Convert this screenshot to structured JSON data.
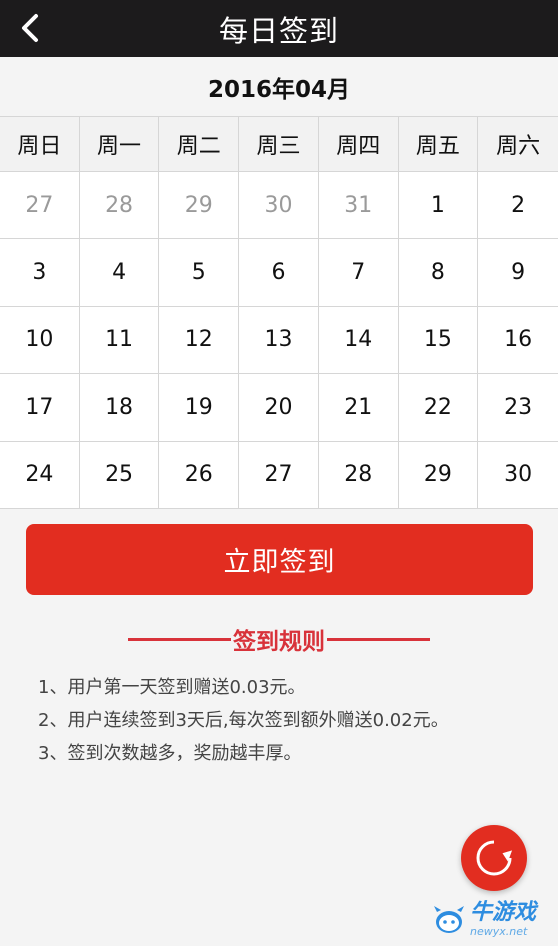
{
  "header": {
    "title": "每日签到",
    "back_icon": "chevron-left-icon"
  },
  "calendar": {
    "month_label": "2016年04月",
    "weekdays": [
      "周日",
      "周一",
      "周二",
      "周三",
      "周四",
      "周五",
      "周六"
    ],
    "days": [
      {
        "label": "27",
        "current_month": false
      },
      {
        "label": "28",
        "current_month": false
      },
      {
        "label": "29",
        "current_month": false
      },
      {
        "label": "30",
        "current_month": false
      },
      {
        "label": "31",
        "current_month": false
      },
      {
        "label": "1",
        "current_month": true
      },
      {
        "label": "2",
        "current_month": true
      },
      {
        "label": "3",
        "current_month": true
      },
      {
        "label": "4",
        "current_month": true
      },
      {
        "label": "5",
        "current_month": true
      },
      {
        "label": "6",
        "current_month": true
      },
      {
        "label": "7",
        "current_month": true
      },
      {
        "label": "8",
        "current_month": true
      },
      {
        "label": "9",
        "current_month": true
      },
      {
        "label": "10",
        "current_month": true
      },
      {
        "label": "11",
        "current_month": true
      },
      {
        "label": "12",
        "current_month": true
      },
      {
        "label": "13",
        "current_month": true
      },
      {
        "label": "14",
        "current_month": true
      },
      {
        "label": "15",
        "current_month": true
      },
      {
        "label": "16",
        "current_month": true
      },
      {
        "label": "17",
        "current_month": true
      },
      {
        "label": "18",
        "current_month": true
      },
      {
        "label": "19",
        "current_month": true
      },
      {
        "label": "20",
        "current_month": true
      },
      {
        "label": "21",
        "current_month": true
      },
      {
        "label": "22",
        "current_month": true
      },
      {
        "label": "23",
        "current_month": true
      },
      {
        "label": "24",
        "current_month": true
      },
      {
        "label": "25",
        "current_month": true
      },
      {
        "label": "26",
        "current_month": true
      },
      {
        "label": "27",
        "current_month": true
      },
      {
        "label": "28",
        "current_month": true
      },
      {
        "label": "29",
        "current_month": true
      },
      {
        "label": "30",
        "current_month": true
      }
    ]
  },
  "actions": {
    "signin_label": "立即签到"
  },
  "rules": {
    "heading": "签到规则",
    "items": [
      "1、用户第一天签到赠送0.03元。",
      "2、用户连续签到3天后,每次签到额外赠送0.02元。",
      "3、签到次数越多，奖励越丰厚。"
    ]
  },
  "fab": {
    "icon": "refresh-icon"
  },
  "watermark": {
    "main": "牛游戏",
    "sub": "newyx.net"
  },
  "colors": {
    "titlebar_bg": "#1c1b1c",
    "accent_red": "#e22d20",
    "rules_red": "#d8323a",
    "muted_day": "#9a9a9a",
    "watermark_blue": "#2e8de0"
  }
}
